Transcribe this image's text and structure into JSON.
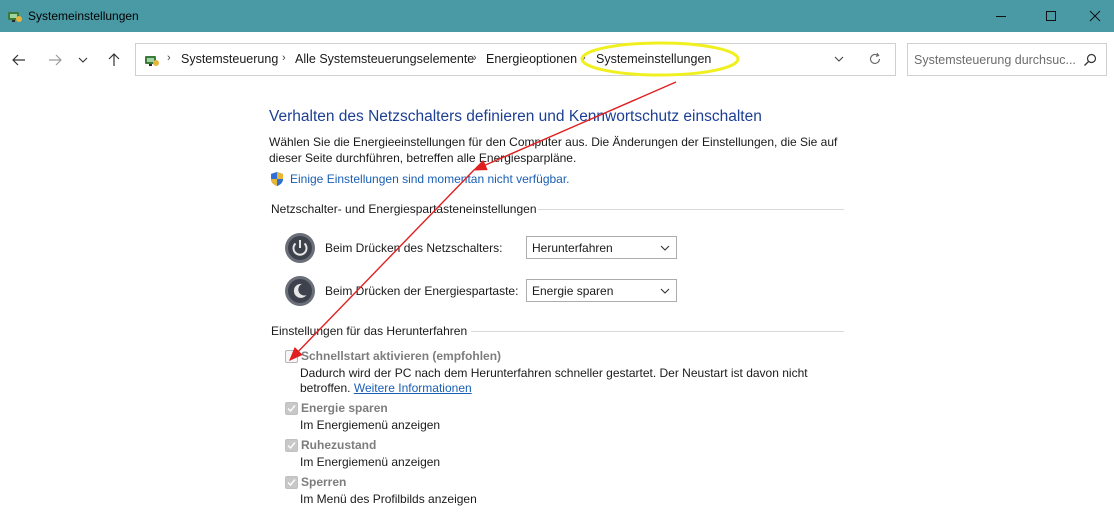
{
  "window": {
    "title": "Systemeinstellungen",
    "accent": "#4a9aa5"
  },
  "nav": {
    "breadcrumbs": [
      "Systemsteuerung",
      "Alle Systemsteuerungselemente",
      "Energieoptionen",
      "Systemeinstellungen"
    ],
    "search_placeholder": "Systemsteuerung durchsuc..."
  },
  "page": {
    "title": "Verhalten des Netzschalters definieren und Kennwortschutz einschalten",
    "description": "Wählen Sie die Energieeinstellungen für den Computer aus. Die Änderungen der Einstellungen, die Sie auf dieser Seite durchführen, betreffen alle Energiesparpläne.",
    "unavailable_link": "Einige Einstellungen sind momentan nicht verfügbar.",
    "title_color": "#1c3f94",
    "link_color": "#1a5fb4"
  },
  "power_section": {
    "header": "Netzschalter- und Energiespartasteneinstellungen",
    "rows": [
      {
        "label": "Beim Drücken des Netzschalters:",
        "value": "Herunterfahren"
      },
      {
        "label": "Beim Drücken der Energiespartaste:",
        "value": "Energie sparen"
      }
    ]
  },
  "shutdown_section": {
    "header": "Einstellungen für das Herunterfahren",
    "options": [
      {
        "title": "Schnellstart aktivieren (empfohlen)",
        "checked": false,
        "desc": "Dadurch wird der PC nach dem Herunterfahren schneller gestartet. Der Neustart ist davon nicht betroffen.",
        "link": "Weitere Informationen"
      },
      {
        "title": "Energie sparen",
        "checked": true,
        "desc": "Im Energiemenü anzeigen"
      },
      {
        "title": "Ruhezustand",
        "checked": true,
        "desc": "Im Energiemenü anzeigen"
      },
      {
        "title": "Sperren",
        "checked": true,
        "desc": "Im Menü des Profilbilds anzeigen"
      }
    ]
  },
  "annotation": {
    "highlight_color": "#f0f020",
    "arrow_color": "#e02020"
  }
}
